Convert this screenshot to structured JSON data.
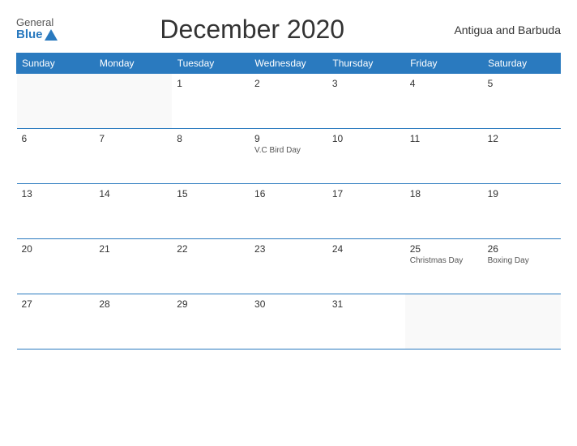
{
  "header": {
    "logo_general": "General",
    "logo_blue": "Blue",
    "title": "December 2020",
    "country": "Antigua and Barbuda"
  },
  "weekdays": [
    "Sunday",
    "Monday",
    "Tuesday",
    "Wednesday",
    "Thursday",
    "Friday",
    "Saturday"
  ],
  "weeks": [
    [
      {
        "num": "",
        "holiday": ""
      },
      {
        "num": "",
        "holiday": ""
      },
      {
        "num": "1",
        "holiday": ""
      },
      {
        "num": "2",
        "holiday": ""
      },
      {
        "num": "3",
        "holiday": ""
      },
      {
        "num": "4",
        "holiday": ""
      },
      {
        "num": "5",
        "holiday": ""
      }
    ],
    [
      {
        "num": "6",
        "holiday": ""
      },
      {
        "num": "7",
        "holiday": ""
      },
      {
        "num": "8",
        "holiday": ""
      },
      {
        "num": "9",
        "holiday": "V.C Bird Day"
      },
      {
        "num": "10",
        "holiday": ""
      },
      {
        "num": "11",
        "holiday": ""
      },
      {
        "num": "12",
        "holiday": ""
      }
    ],
    [
      {
        "num": "13",
        "holiday": ""
      },
      {
        "num": "14",
        "holiday": ""
      },
      {
        "num": "15",
        "holiday": ""
      },
      {
        "num": "16",
        "holiday": ""
      },
      {
        "num": "17",
        "holiday": ""
      },
      {
        "num": "18",
        "holiday": ""
      },
      {
        "num": "19",
        "holiday": ""
      }
    ],
    [
      {
        "num": "20",
        "holiday": ""
      },
      {
        "num": "21",
        "holiday": ""
      },
      {
        "num": "22",
        "holiday": ""
      },
      {
        "num": "23",
        "holiday": ""
      },
      {
        "num": "24",
        "holiday": ""
      },
      {
        "num": "25",
        "holiday": "Christmas Day"
      },
      {
        "num": "26",
        "holiday": "Boxing Day"
      }
    ],
    [
      {
        "num": "27",
        "holiday": ""
      },
      {
        "num": "28",
        "holiday": ""
      },
      {
        "num": "29",
        "holiday": ""
      },
      {
        "num": "30",
        "holiday": ""
      },
      {
        "num": "31",
        "holiday": ""
      },
      {
        "num": "",
        "holiday": ""
      },
      {
        "num": "",
        "holiday": ""
      }
    ]
  ]
}
